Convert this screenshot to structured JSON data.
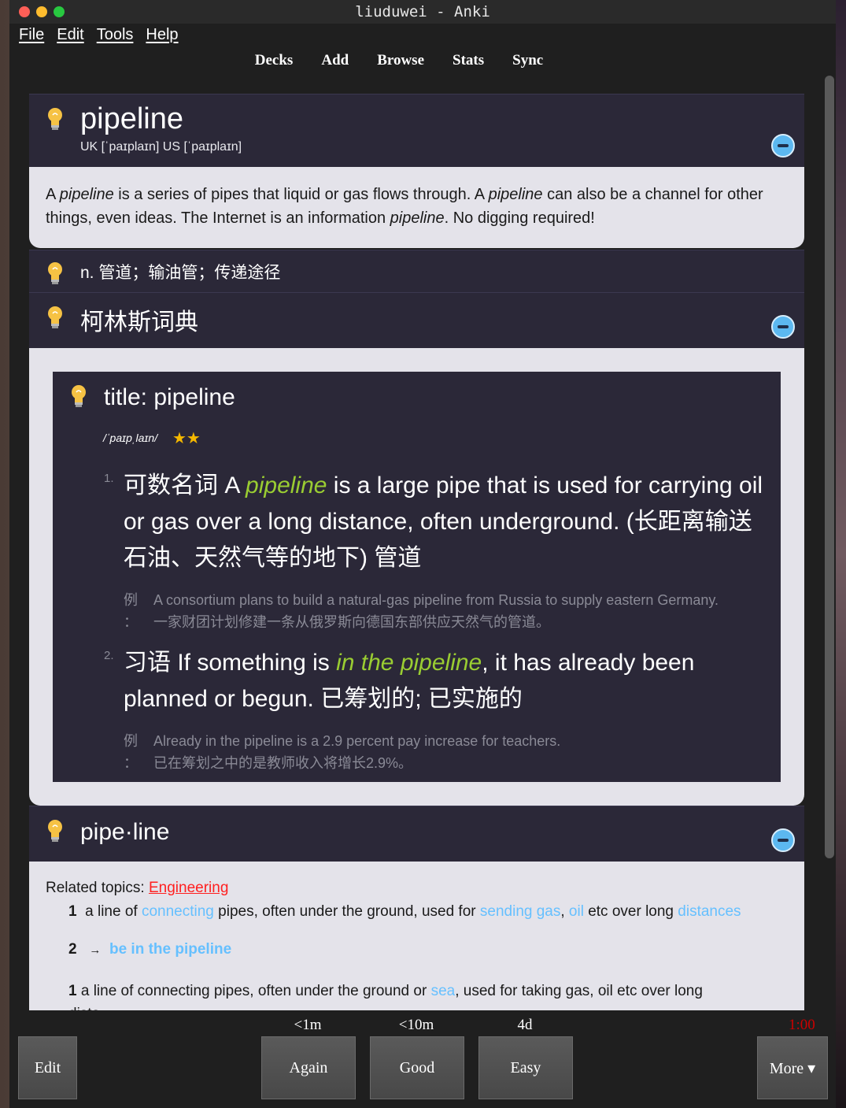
{
  "window": {
    "title": "liuduwei - Anki"
  },
  "menu": {
    "file": "File",
    "edit": "Edit",
    "tools": "Tools",
    "help": "Help"
  },
  "toolbar": {
    "decks": "Decks",
    "add": "Add",
    "browse": "Browse",
    "stats": "Stats",
    "sync": "Sync"
  },
  "card1": {
    "word": "pipeline",
    "phonetic": "UK [ˈpaɪplaɪn] US [ˈpaɪplaɪn]",
    "desc": {
      "p1": "A ",
      "w1": "pipeline",
      "p2": " is a series of pipes that liquid or gas flows through. A ",
      "w2": "pipeline",
      "p3": " can also be a channel for other things, even ideas. The Internet is an information ",
      "w3": "pipeline",
      "p4": ". No digging required!"
    }
  },
  "card2": {
    "text": "n. 管道；输油管；传递途径"
  },
  "card3": {
    "title": "柯林斯词典",
    "inner_title": "title: pipeline",
    "phonetic": "/ˈpaɪpˌlaɪn/",
    "stars": "★★",
    "def1": {
      "num": "1.",
      "pre": "可数名词 A ",
      "hl": "pipeline",
      "post": " is a large pipe that is used for carrying oil or gas over a long distance, often underground. (长距离输送石油、天然气等的地下) 管道",
      "ex_label1": "例",
      "ex_label2": "：",
      "ex_en": "A consortium plans to build a natural-gas pipeline from Russia to supply eastern Germany.",
      "ex_zh": "一家财团计划修建一条从俄罗斯向德国东部供应天然气的管道。"
    },
    "def2": {
      "num": "2.",
      "pre": "习语 If something is ",
      "hl": "in the pipeline",
      "post": ", it has already been planned or begun. 已筹划的; 已实施的",
      "ex_label1": "例",
      "ex_label2": "：",
      "ex_en": "Already in the pipeline is a 2.9 percent pay increase for teachers.",
      "ex_zh": "已在筹划之中的是教师收入将增长2.9%。"
    }
  },
  "card4": {
    "word": "pipe·line",
    "related_label": "Related topics:",
    "related_link": "Engineering",
    "s1": {
      "num": "1",
      "a": "a line of ",
      "l1": "connecting",
      "b": " pipes, often under the ground, used for ",
      "l2": "sending gas",
      "c": ", ",
      "l3": "oil",
      "d": " etc over long ",
      "l4": "distances"
    },
    "s2": {
      "num": "2",
      "arrow": "→",
      "link": "be in the pipeline"
    },
    "s3": {
      "num": "1",
      "a": " a line of connecting pipes, often under the ground or ",
      "l1": "sea",
      "b": ", used for taking gas, oil etc over long",
      "c": "dista"
    }
  },
  "bottom": {
    "edit": "Edit",
    "again": "Again",
    "again_time": "<1m",
    "good": "Good",
    "good_time": "<10m",
    "easy": "Easy",
    "easy_time": "4d",
    "more": "More ▾",
    "timer": "1:00"
  },
  "colors": {
    "accent_green": "#9acd32",
    "link_blue": "#66c0ff",
    "link_red": "#ff2020",
    "timer_red": "#cc0000"
  }
}
